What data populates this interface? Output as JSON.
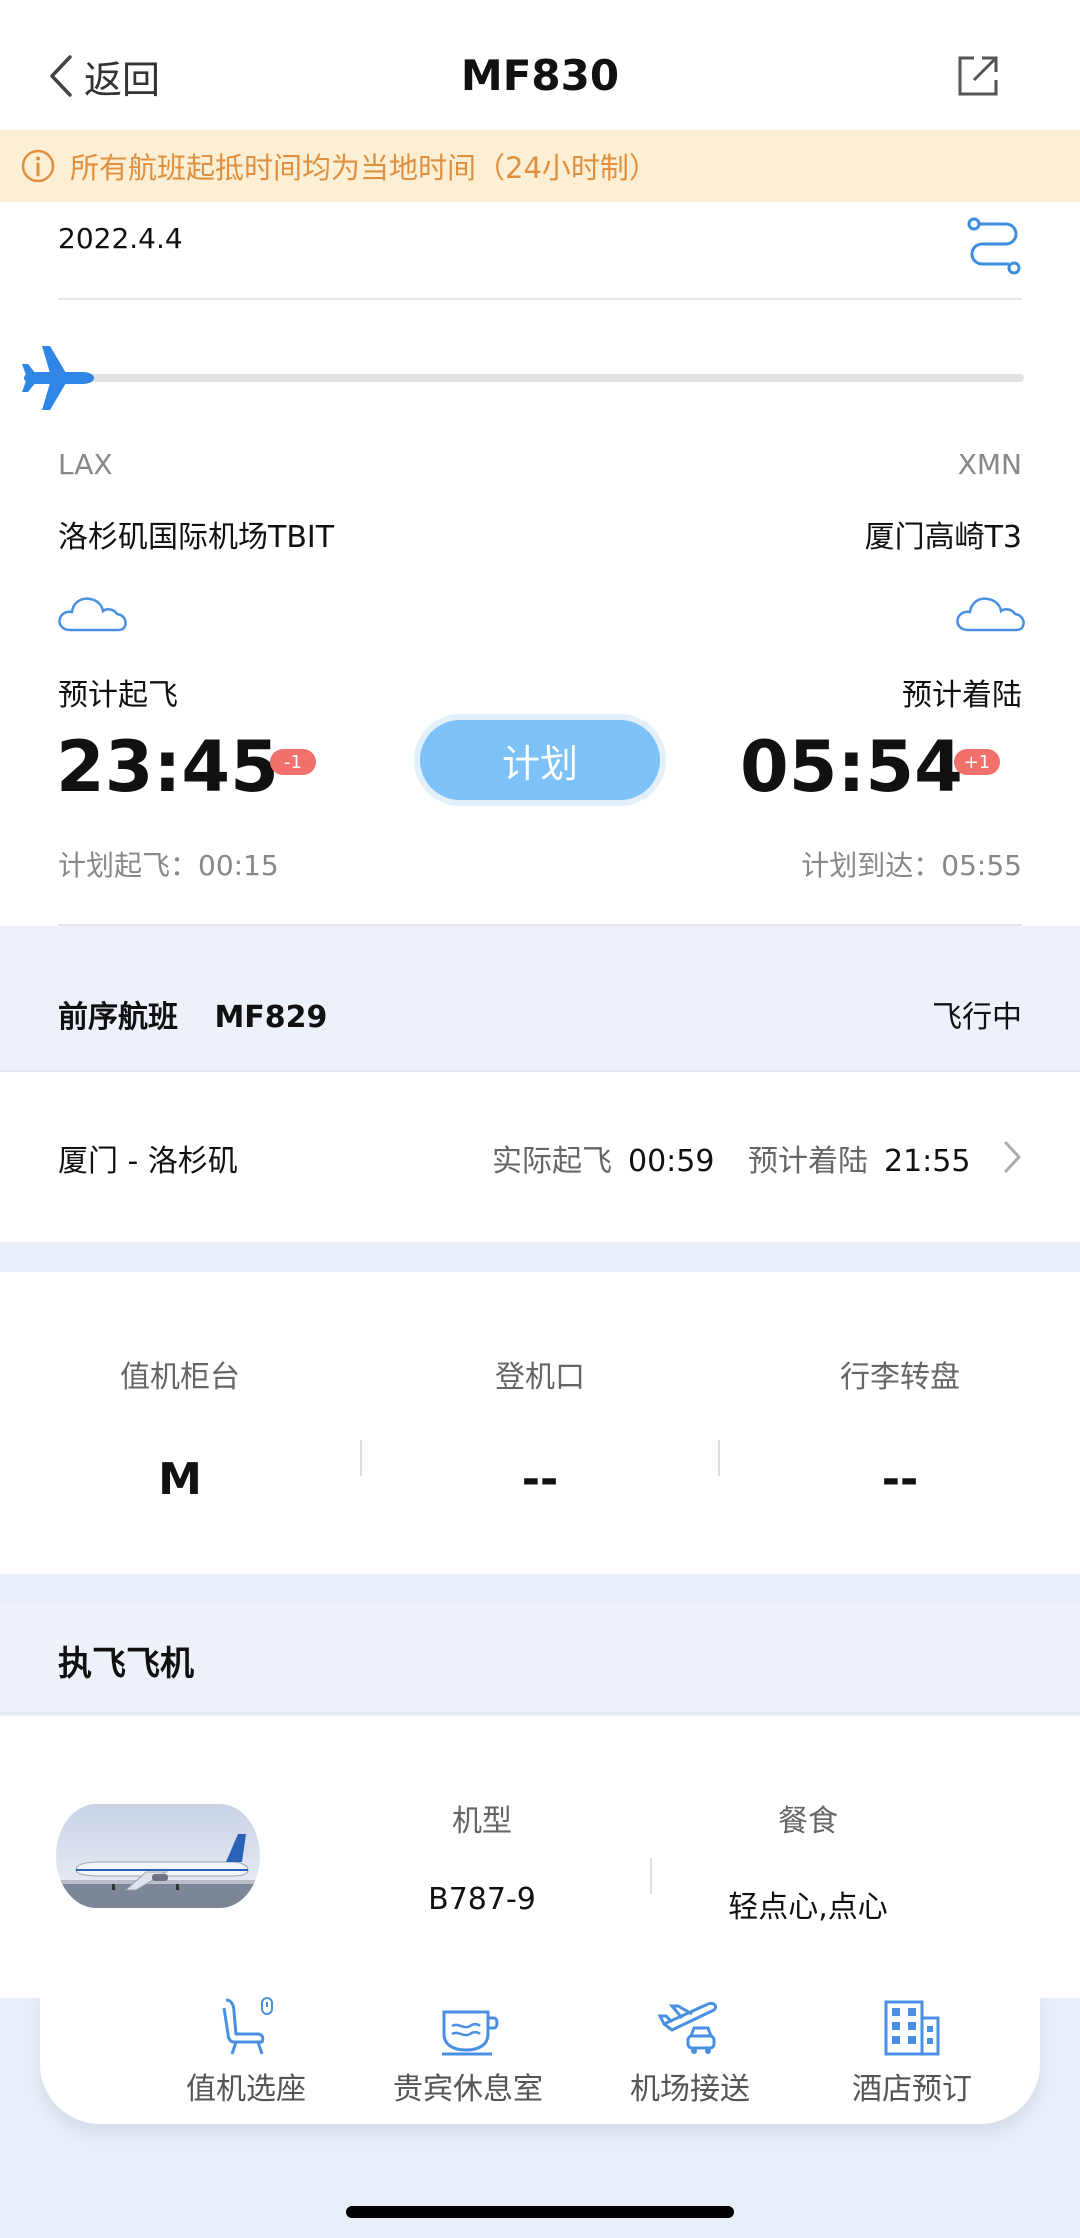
{
  "header": {
    "back_label": "返回",
    "title": "MF830"
  },
  "notice": "所有航班起抵时间均为当地时间（24小时制）",
  "flight": {
    "date": "2022.4.4",
    "progress": 0,
    "departure": {
      "code": "LAX",
      "airport": "洛杉矶国际机场TBIT",
      "label": "预计起飞",
      "time": "23:45",
      "day_offset": "-1",
      "plan_label": "计划起飞：",
      "plan_time": "00:15"
    },
    "arrival": {
      "code": "XMN",
      "airport": "厦门高崎T3",
      "label": "预计着陆",
      "time": "05:54",
      "day_offset": "+1",
      "plan_label": "计划到达：",
      "plan_time": "05:55"
    },
    "status": "计划"
  },
  "previous_flight": {
    "title": "前序航班",
    "number": "MF829",
    "status": "飞行中",
    "route": "厦门 - 洛杉矶",
    "actual_takeoff_label": "实际起飞",
    "actual_takeoff": "00:59",
    "est_landing_label": "预计着陆",
    "est_landing": "21:55"
  },
  "counters": [
    {
      "label": "值机柜台",
      "value": "M"
    },
    {
      "label": "登机口",
      "value": "--"
    },
    {
      "label": "行李转盘",
      "value": "--"
    }
  ],
  "aircraft": {
    "section_title": "执飞飞机",
    "type_label": "机型",
    "type_value": "B787-9",
    "meal_label": "餐食",
    "meal_value": "轻点心,点心"
  },
  "services": [
    {
      "label": "值机选座",
      "icon": "seat-icon"
    },
    {
      "label": "贵宾休息室",
      "icon": "lounge-icon"
    },
    {
      "label": "机场接送",
      "icon": "airport-transfer-icon"
    },
    {
      "label": "酒店预订",
      "icon": "hotel-icon"
    }
  ],
  "colors": {
    "accent_blue": "#4a90e2",
    "status_pill": "#7cc1f8",
    "notice_bg": "#fcefd4",
    "notice_text": "#e0903f",
    "badge_red": "#f2706b"
  }
}
